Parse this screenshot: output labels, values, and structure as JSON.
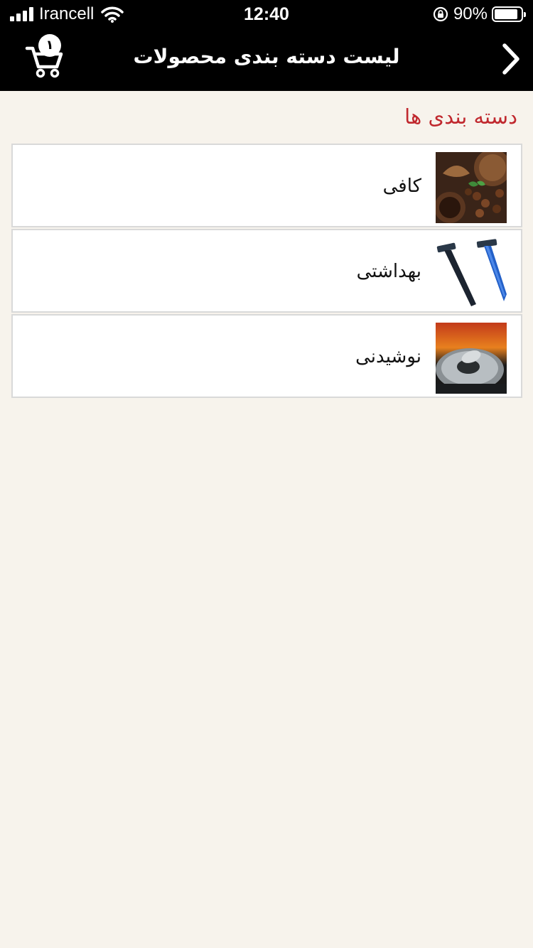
{
  "status_bar": {
    "carrier": "Irancell",
    "time": "12:40",
    "battery_percent": "90%",
    "battery_level": 0.9
  },
  "header": {
    "title": "لیست دسته بندی محصولات",
    "cart_count": "۱",
    "cart_icon": "cart-icon",
    "back_icon": "chevron-right-icon"
  },
  "section": {
    "title": "دسته بندی ها"
  },
  "categories": [
    {
      "label": "کافی",
      "image": "coffee-beans-image"
    },
    {
      "label": "بهداشتی",
      "image": "razors-image"
    },
    {
      "label": "نوشیدنی",
      "image": "soda-can-image"
    }
  ],
  "colors": {
    "header_bg": "#000000",
    "page_bg": "#f7f3ec",
    "accent": "#c0282e"
  }
}
